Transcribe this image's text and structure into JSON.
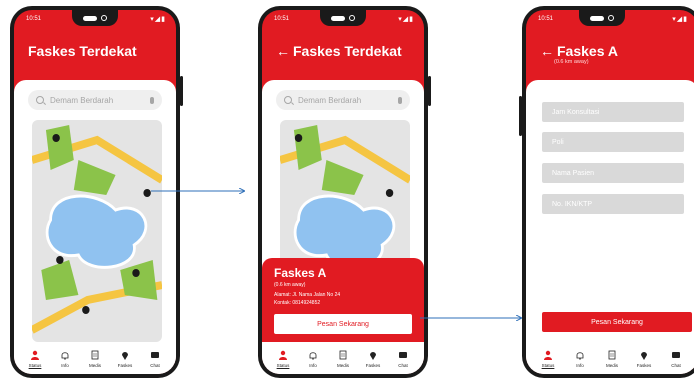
{
  "statusbar": {
    "time": "10:51",
    "signal": "▾◢▮"
  },
  "screen1": {
    "title": "Faskes Terdekat",
    "search_placeholder": "Demam Berdarah"
  },
  "screen2": {
    "title": "Faskes Terdekat",
    "search_placeholder": "Demam Berdarah",
    "card": {
      "name": "Faskes A",
      "distance": "(0.6 km away)",
      "address": "Alamat: Jl. Nama Jalan No 24",
      "contact": "Kontak: 0814924852",
      "button_label": "Pesan Sekarang"
    }
  },
  "screen3": {
    "title": "Faskes A",
    "subtitle": "(0.6 km away)",
    "fields": [
      "Jam Konsultasi",
      "Poli",
      "Nama Pasien",
      "No. IKN/KTP"
    ],
    "button_label": "Pesan Sekarang"
  },
  "tabs": [
    {
      "label": "Status",
      "icon": "person-icon",
      "active": true
    },
    {
      "label": "Info",
      "icon": "bell-icon",
      "active": false
    },
    {
      "label": "Medis",
      "icon": "document-icon",
      "active": false
    },
    {
      "label": "Faskes",
      "icon": "location-pin-icon",
      "active": false
    },
    {
      "label": "Chat",
      "icon": "chat-icon",
      "active": false
    }
  ],
  "colors": {
    "brand": "#e11b22",
    "arrow": "#2e6fb8"
  }
}
